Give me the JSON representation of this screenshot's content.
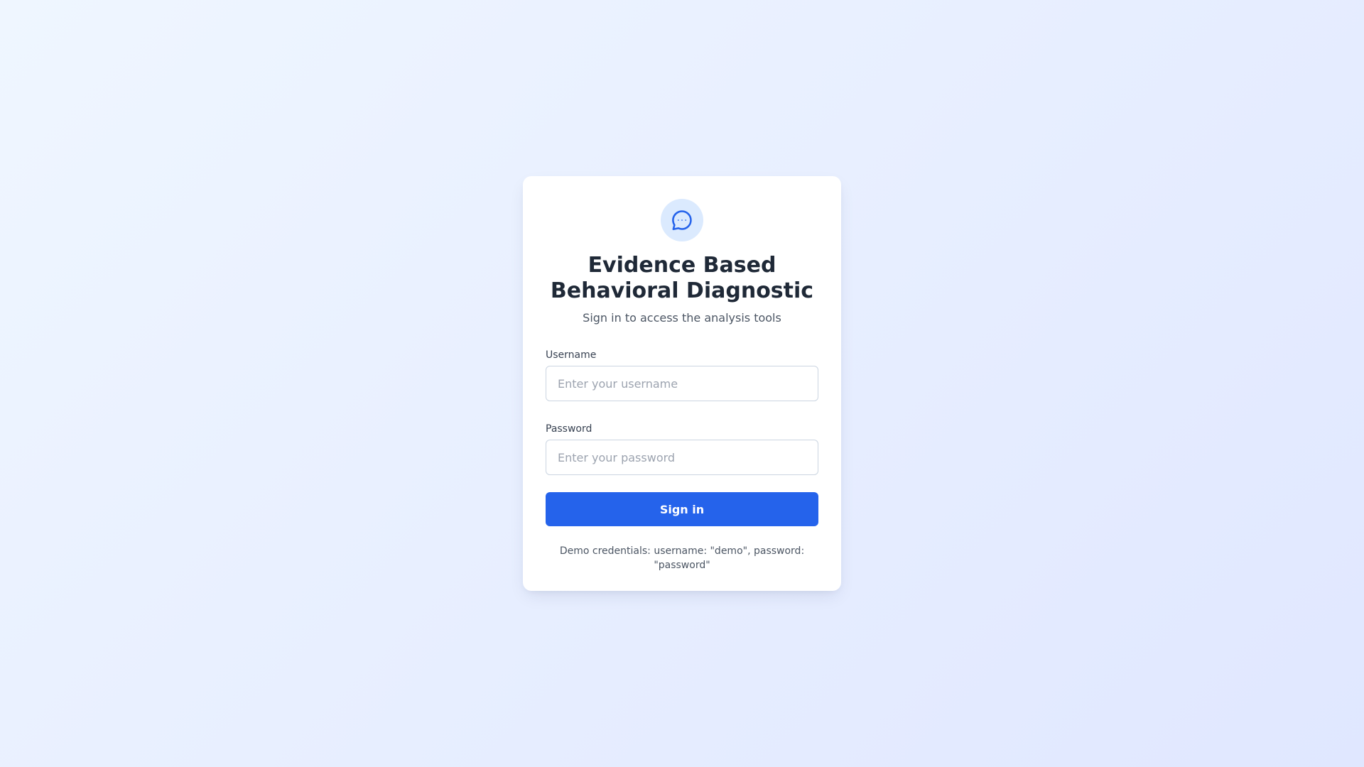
{
  "brand": {
    "icon": "chat-bubble-icon",
    "title": "Evidence Based Behavioral Diagnostic",
    "subtitle": "Sign in to access the analysis tools"
  },
  "form": {
    "username": {
      "label": "Username",
      "placeholder": "Enter your username",
      "value": ""
    },
    "password": {
      "label": "Password",
      "placeholder": "Enter your password",
      "value": ""
    },
    "submit_label": "Sign in"
  },
  "footer": {
    "demo_note": "Demo credentials: username: \"demo\", password: \"password\""
  },
  "colors": {
    "accent": "#2563eb",
    "icon_bg": "#dbeafe",
    "title": "#1f2937",
    "muted": "#4b5563"
  }
}
